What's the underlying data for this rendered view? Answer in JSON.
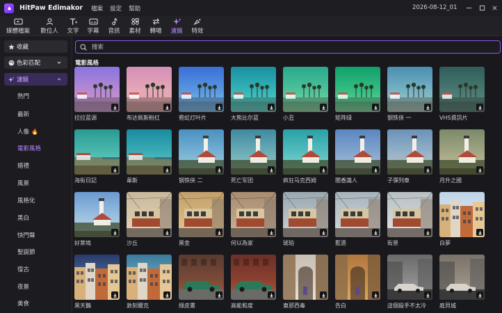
{
  "app": {
    "title": "HitPaw Edimakor",
    "menu": [
      "檔案",
      "設定",
      "幫助"
    ],
    "project_name": "2026-08-12_01"
  },
  "toolbar": [
    {
      "label": "媒體檔案",
      "icon": "media-icon"
    },
    {
      "label": "數位人",
      "icon": "avatar-icon"
    },
    {
      "label": "文字",
      "icon": "text-icon"
    },
    {
      "label": "字幕",
      "icon": "subtitle-icon"
    },
    {
      "label": "音訊",
      "icon": "music-note-icon"
    },
    {
      "label": "素材",
      "icon": "elements-icon"
    },
    {
      "label": "轉場",
      "icon": "transition-icon"
    },
    {
      "label": "濾鏡",
      "icon": "filter-sparkle-icon",
      "active": true
    },
    {
      "label": "特效",
      "icon": "effects-icon"
    }
  ],
  "sidebar": {
    "favorites": "收藏",
    "color_match": "色彩匹配",
    "filters": "濾鏡",
    "items": [
      "熱門",
      "最新",
      "人像",
      "電影風格",
      "婚禮",
      "風景",
      "風格化",
      "黑白",
      "快門聲",
      "聖誕節",
      "復古",
      "夜景",
      "美食"
    ],
    "selected": "電影風格"
  },
  "search": {
    "placeholder": "搜索",
    "value": ""
  },
  "section_title": "電影風格",
  "filters": [
    {
      "name": "拉拉蓝调",
      "scene": "palm",
      "sky": [
        "#8a74e0",
        "#b98ad2",
        "#c9a0c6"
      ]
    },
    {
      "name": "布达佩斯粉红",
      "scene": "palm",
      "sky": [
        "#d48fb8",
        "#e6a8b6",
        "#d9a9a6"
      ]
    },
    {
      "name": "霓虹灯叶片",
      "scene": "palm",
      "sky": [
        "#3a6fd6",
        "#5a9ae0",
        "#8cc0e6"
      ]
    },
    {
      "name": "大熊比尔蓝",
      "scene": "palm",
      "sky": [
        "#1a8fa0",
        "#35b7b8",
        "#79d2c4"
      ]
    },
    {
      "name": "小丑",
      "scene": "palm",
      "sky": [
        "#2aa88e",
        "#4fc49a",
        "#9ad0a0"
      ]
    },
    {
      "name": "矩阵绿",
      "scene": "palm",
      "sky": [
        "#12a06a",
        "#35bf83",
        "#8fd4a0"
      ]
    },
    {
      "name": "钢铁侠 一",
      "scene": "palm",
      "sky": [
        "#4a8fb0",
        "#78b4c4",
        "#b8c9b8"
      ]
    },
    {
      "name": "VHS資訊片",
      "scene": "palm",
      "sky": [
        "#2f5e5a",
        "#4a7a72",
        "#6a8a80"
      ]
    },
    {
      "name": "海街日記",
      "scene": "coast",
      "sky": [
        "#2a9a92",
        "#4fbcb2",
        "#8fd0c4"
      ]
    },
    {
      "name": "韋斯",
      "scene": "coast",
      "sky": [
        "#1a8aa0",
        "#3fb0b8",
        "#8acac4"
      ]
    },
    {
      "name": "钢铁侠 二",
      "scene": "lighthouse",
      "sky": [
        "#4a90c0",
        "#7ab4d4",
        "#b6d0d8"
      ]
    },
    {
      "name": "死亡军团",
      "scene": "lighthouse",
      "sky": [
        "#3f8aa0",
        "#6fb0b8",
        "#a8cac4"
      ]
    },
    {
      "name": "疯狂马克西姆",
      "scene": "lighthouse",
      "sky": [
        "#2aa0a8",
        "#58c0c0",
        "#a0d6cc"
      ]
    },
    {
      "name": "闇香識人",
      "scene": "lighthouse",
      "sky": [
        "#5a86c0",
        "#86a8d0",
        "#b8c6d4"
      ]
    },
    {
      "name": "子彈列車",
      "scene": "lighthouse",
      "sky": [
        "#6a92b8",
        "#98b4c8",
        "#d0c6b4"
      ]
    },
    {
      "name": "月升之國",
      "scene": "lighthouse",
      "sky": [
        "#7a8a6a",
        "#a6a886",
        "#cfc6a0"
      ]
    },
    {
      "name": "好萊塢",
      "scene": "lighthouse",
      "sky": [
        "#6a9ad0",
        "#9cc0e0",
        "#cfdde6"
      ]
    },
    {
      "name": "沙丘",
      "scene": "tram",
      "sky": [
        "#c8b89c",
        "#d8c8ac",
        "#e4d6bc"
      ]
    },
    {
      "name": "黑金",
      "scene": "tram",
      "sky": [
        "#c4a06a",
        "#d6b47e",
        "#e2c696"
      ]
    },
    {
      "name": "何以為家",
      "scene": "tram",
      "sky": [
        "#a88c70",
        "#bca086",
        "#cbb49c"
      ]
    },
    {
      "name": "琥珀",
      "scene": "tram",
      "sky": [
        "#9aa8b0",
        "#b4bec4",
        "#ccd2d4"
      ]
    },
    {
      "name": "藍懣",
      "scene": "tram",
      "sky": [
        "#a8b4bc",
        "#c0c8cc",
        "#d6dadc"
      ]
    },
    {
      "name": "街景",
      "scene": "tram",
      "sky": [
        "#b8c0c4",
        "#ccd2d4",
        "#dee2e2"
      ]
    },
    {
      "name": "白夢",
      "scene": "houses",
      "sky": [
        "#c0d4e8",
        "#d4e2ee",
        "#e6eef4"
      ]
    },
    {
      "name": "黑天鵝",
      "scene": "houses",
      "sky": [
        "#2a3a6a",
        "#4a6a9a",
        "#c8a88a"
      ]
    },
    {
      "name": "敦刻爾克",
      "scene": "houses",
      "sky": [
        "#3a7a9a",
        "#6aa6c0",
        "#c8b89a"
      ]
    },
    {
      "name": "綠皮書",
      "scene": "car",
      "sky": [
        "#5a3a30",
        "#7a4a38",
        "#a45a3e"
      ]
    },
    {
      "name": "高能和度",
      "scene": "car",
      "sky": [
        "#6a3028",
        "#8a4030",
        "#b4583a"
      ]
    },
    {
      "name": "東邪西毒",
      "scene": "alley",
      "sky": [
        "#c8c0b4",
        "#d8cec0",
        "#e8e0d4"
      ]
    },
    {
      "name": "告白",
      "scene": "alley",
      "sky": [
        "#b07840",
        "#c8904c",
        "#d8a862"
      ]
    },
    {
      "name": "這個殺手不太冷",
      "scene": "street",
      "sky": [
        "#6a6a6a",
        "#8a8a8a",
        "#a6a6a6"
      ]
    },
    {
      "name": "庭貝城",
      "scene": "street",
      "sky": [
        "#7a7268",
        "#968c80",
        "#b0a698"
      ]
    }
  ]
}
